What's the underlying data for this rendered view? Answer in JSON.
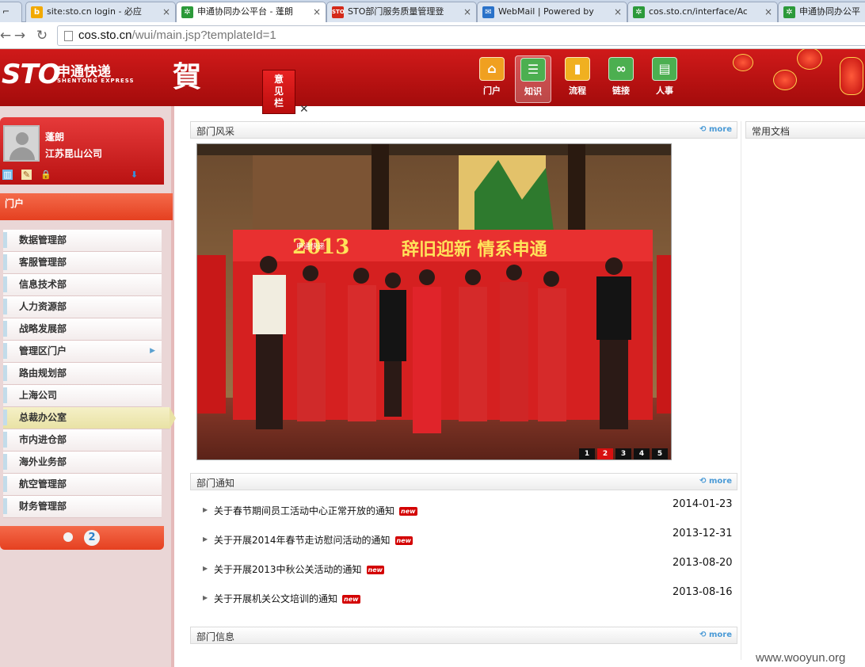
{
  "browser": {
    "tabs": [
      {
        "label": "site:sto.cn login - 必应  Bing",
        "icon": "bing-icon",
        "color": "#f2a900"
      },
      {
        "label": "申通协同办公平台 - 蓬朗",
        "icon": "gear-icon",
        "color": "#2c9a3a"
      },
      {
        "label": "STO部门服务质量管理登",
        "icon": "sto-icon",
        "color": "#d42a1a"
      },
      {
        "label": "WebMail | Powered by Winmai",
        "icon": "mail-icon",
        "color": "#2a72c9"
      },
      {
        "label": "cos.sto.cn/interface/Account",
        "icon": "gear-icon",
        "color": "#2c9a3a"
      },
      {
        "label": "申通协同办公平",
        "icon": "gear-icon",
        "color": "#2c9a3a"
      }
    ],
    "url": "cos.sto.cn",
    "url_path": "/wui/main.jsp?templateId=1"
  },
  "header": {
    "logo_text": "STO",
    "logo_cn": "申通快递",
    "logo_en": "SHENTONG EXPRESS",
    "greeting": "賀",
    "feedback": "意见栏",
    "nav": [
      {
        "label": "门户",
        "icon": "home-icon",
        "color": "#f0a020"
      },
      {
        "label": "知识",
        "icon": "knowledge-icon",
        "color": "#4caf50"
      },
      {
        "label": "流程",
        "icon": "chart-icon",
        "color": "#f0b020"
      },
      {
        "label": "链接",
        "icon": "link-icon",
        "color": "#4caf50"
      },
      {
        "label": "人事",
        "icon": "person-icon",
        "color": "#4caf50"
      }
    ]
  },
  "user": {
    "name": "蓬朗",
    "company": "江苏昆山公司"
  },
  "sidebar": {
    "portal_label": "门户",
    "items": [
      {
        "label": "数据管理部"
      },
      {
        "label": "客服管理部"
      },
      {
        "label": "信息技术部"
      },
      {
        "label": "人力资源部"
      },
      {
        "label": "战略发展部"
      },
      {
        "label": "管理区门户",
        "submenu": true
      },
      {
        "label": "路由规划部"
      },
      {
        "label": "上海公司"
      },
      {
        "label": "总裁办公室",
        "active": true
      },
      {
        "label": "市内进仓部"
      },
      {
        "label": "海外业务部"
      },
      {
        "label": "航空管理部"
      },
      {
        "label": "财务管理部"
      }
    ],
    "pager": {
      "current": "2"
    }
  },
  "sections": {
    "style": {
      "title": "部门风采",
      "more": "more"
    },
    "notice": {
      "title": "部门通知",
      "more": "more"
    },
    "info": {
      "title": "部门信息",
      "more": "more"
    },
    "docs": {
      "title": "常用文档"
    }
  },
  "photo": {
    "banner_title": "辞旧迎新 情系申通",
    "banner_year": "2013",
    "banner_logo": "申通快递",
    "slides": [
      "1",
      "2",
      "3",
      "4",
      "5"
    ],
    "current_slide": "2"
  },
  "notices": [
    {
      "title": "关于春节期间员工活动中心正常开放的通知",
      "date": "2014-01-23",
      "badge": "new"
    },
    {
      "title": "关于开展2014年春节走访慰问活动的通知",
      "date": "2013-12-31",
      "badge": "new"
    },
    {
      "title": "关于开展2013中秋公关活动的通知",
      "date": "2013-08-20",
      "badge": "new"
    },
    {
      "title": "关于开展机关公文培训的通知",
      "date": "2013-08-16",
      "badge": "new"
    }
  ],
  "watermark": "www.wooyun.org",
  "colors": {
    "header_red": "#c61414",
    "sidebar_orange": "#e54020",
    "active_menu": "#f5f0c7",
    "link_blue": "#4a9ad6"
  }
}
